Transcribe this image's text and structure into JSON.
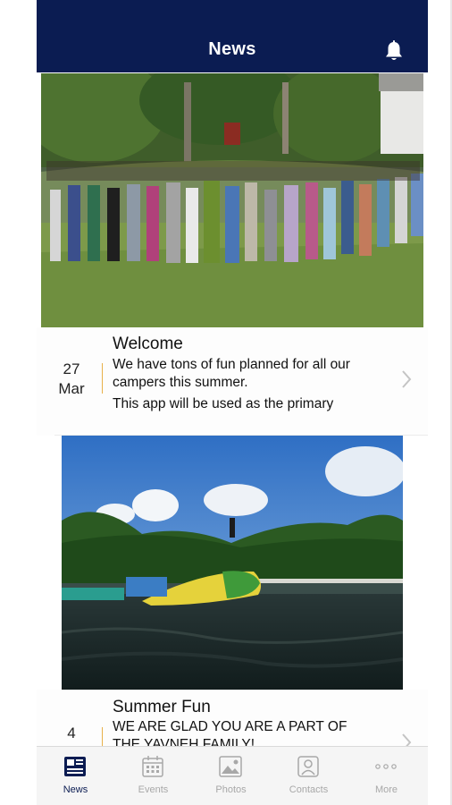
{
  "header": {
    "title": "News",
    "bell_icon": "bell-icon"
  },
  "news": [
    {
      "day": "27",
      "month": "Mar",
      "title": "Welcome",
      "body_line1": "We have tons of fun planned for all our",
      "body_line2": "campers this summer.",
      "body_line3": "This app will be used as the primary"
    },
    {
      "day": "4",
      "month": "",
      "title": "Summer Fun",
      "body_line1": "WE ARE GLAD YOU ARE A PART OF",
      "body_line2": "THE YAVNEH FAMILY!"
    }
  ],
  "tabs": [
    {
      "label": "News",
      "icon": "newspaper-icon",
      "active": true
    },
    {
      "label": "Events",
      "icon": "calendar-icon",
      "active": false
    },
    {
      "label": "Photos",
      "icon": "photo-icon",
      "active": false
    },
    {
      "label": "Contacts",
      "icon": "contact-icon",
      "active": false
    },
    {
      "label": "More",
      "icon": "more-dots-icon",
      "active": false
    }
  ],
  "colors": {
    "header": "#0b1c52",
    "accent_divider": "#e8b04a",
    "tab_inactive": "#a8a8a8"
  }
}
